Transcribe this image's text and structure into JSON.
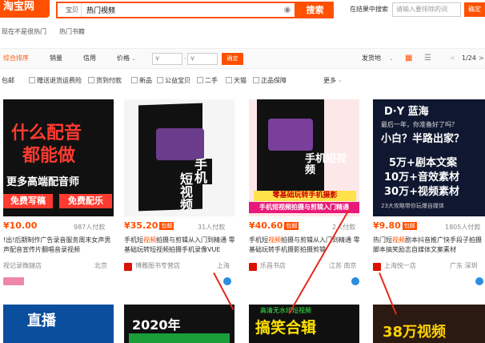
{
  "header": {
    "logo": "淘宝网",
    "search_category": "宝贝",
    "search_query": "热门视频",
    "search_button": "搜索",
    "in_result_label": "在结果中搜索",
    "in_result_placeholder": "请输入要排除的词",
    "in_result_button": "确定"
  },
  "hot_words": [
    "现在不是很热门",
    "热门书籍"
  ],
  "sortbar": {
    "tabs": [
      "综合排序",
      "销量",
      "信用",
      "价格"
    ],
    "price_from": "¥",
    "price_to": "¥",
    "price_button": "确定",
    "ship_from": "发货地",
    "page": "1/24"
  },
  "filters": [
    "包邮",
    "赠送退货运费险",
    "货到付款",
    "新品",
    "公益宝贝",
    "二手",
    "天猫",
    "正品保障",
    "更多"
  ],
  "items": [
    {
      "img_top": "什么配音",
      "img_mid": "都能做",
      "img_sub": "更多高端配音师",
      "img_b1": "免费写稿",
      "img_b2": "免费配乐",
      "price": "10.00",
      "paid": "987人付款",
      "title": "!出!后期制作广告录音服务周末女声男声配音宣传片翻唱音录视频",
      "shop": "视记录微鏈店",
      "loc": "北京"
    },
    {
      "img_top": "手机",
      "img_mid": "短视频",
      "price": "35.20",
      "badge": "包邮",
      "paid": "31人付款",
      "title_pre": "手机短",
      "title_hl": "视频",
      "title_post": "拍摄与剪辑从入门到精通 零基础玩转短视频拍摄手机录像VUE",
      "shop": "博雅图书专营店",
      "loc": "上海"
    },
    {
      "img_top": "手机短视频",
      "img_strip1": "零基础玩转手机摄影",
      "img_strip2": "手机短视频拍摄与剪辑入门精通",
      "price": "40.60",
      "badge": "包邮",
      "paid": "2人付款",
      "title_pre": "手机短",
      "title_hl": "视频",
      "title_post": "拍摄与剪辑从入门到精通 零基础玩转手机摄影拍摄剪辑",
      "shop": "乐昌书店",
      "loc": "江苏 南京"
    },
    {
      "img_top": "D·Y 蓝海",
      "img_q1": "最后一年，你准备好了吗？",
      "img_q2": "小白？半路出家？",
      "img_l1": "5万+剧本文案",
      "img_l2": "10万+音效素材",
      "img_l3": "30万+视频素材",
      "img_foot": "23大攻略带你玩爆自媒体",
      "price": "9.80",
      "badge": "包邮",
      "paid": "1805人付款",
      "title_pre": "热门短",
      "title_hl": "视频",
      "title_post": "剧本抖音推广快手段子拍摄脚本搞笑励志自媒体文案素材",
      "shop": "上海悦一店",
      "loc": "广东 深圳"
    }
  ],
  "bottom": {
    "b1": "直播",
    "b2": "2020年",
    "b3_top": "高清无水印短视频",
    "b3_main": "搞笑合辑",
    "b4": "38万视频"
  }
}
